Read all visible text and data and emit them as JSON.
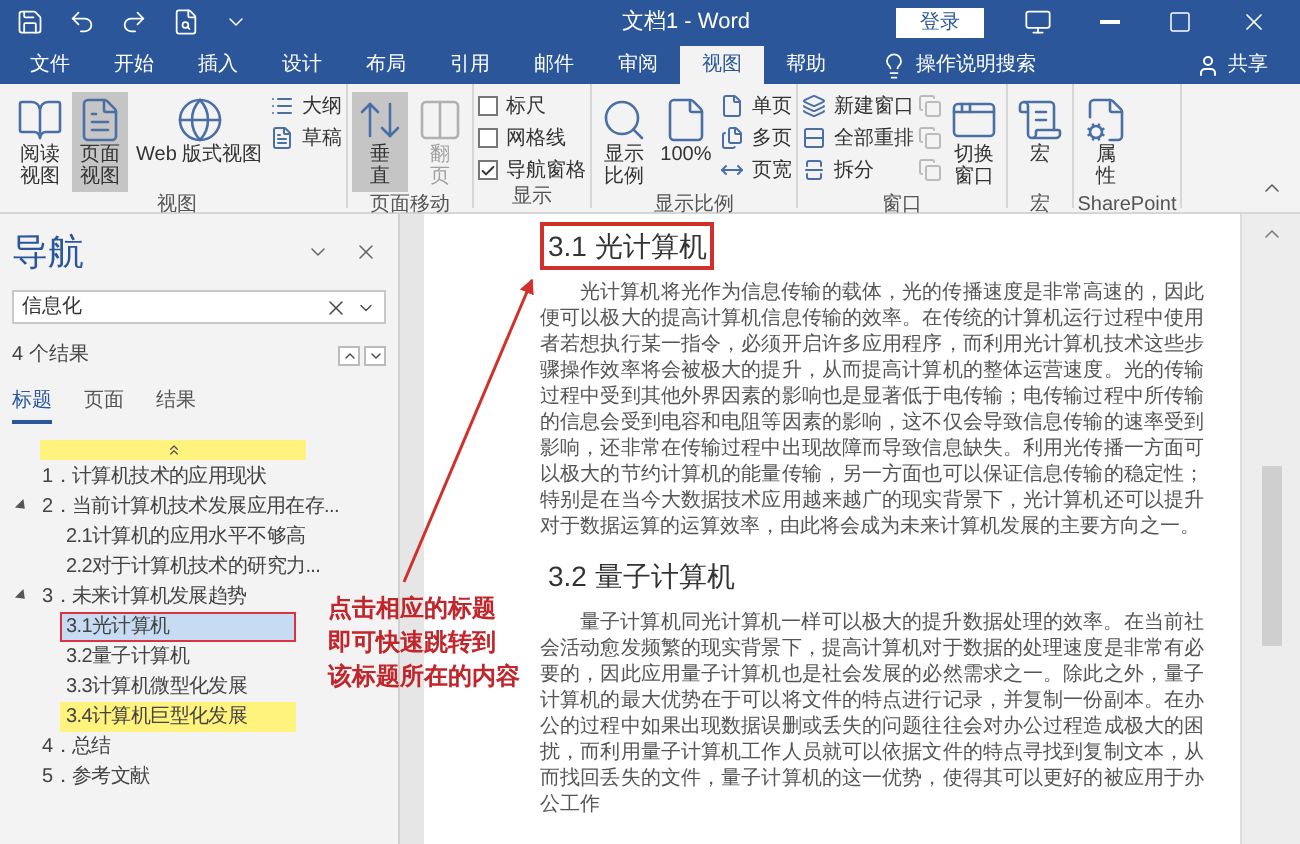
{
  "title_bar": {
    "title": "文档1 - Word",
    "login_button": "登录"
  },
  "menu_tabs": [
    {
      "label": "文件",
      "selected": false
    },
    {
      "label": "开始",
      "selected": false
    },
    {
      "label": "插入",
      "selected": false
    },
    {
      "label": "设计",
      "selected": false
    },
    {
      "label": "布局",
      "selected": false
    },
    {
      "label": "引用",
      "selected": false
    },
    {
      "label": "邮件",
      "selected": false
    },
    {
      "label": "审阅",
      "selected": false
    },
    {
      "label": "视图",
      "selected": true
    },
    {
      "label": "帮助",
      "selected": false
    }
  ],
  "tell_me": "操作说明搜索",
  "share": "共享",
  "ribbon_groups": [
    {
      "label": "视图",
      "items": [
        {
          "kind": "large",
          "label": "阅读视图",
          "selected": false
        },
        {
          "kind": "large",
          "label": "页面视图",
          "selected": true
        },
        {
          "kind": "large",
          "label": "Web 版式视图",
          "selected": false
        },
        {
          "kind": "small",
          "label": "大纲"
        },
        {
          "kind": "small",
          "label": "草稿"
        }
      ]
    },
    {
      "label": "页面移动",
      "items": [
        {
          "kind": "large",
          "label": "垂直",
          "selected": true,
          "disabled": false
        },
        {
          "kind": "large",
          "label": "翻页",
          "selected": false,
          "disabled": true
        }
      ]
    },
    {
      "label": "显示",
      "items": [
        {
          "kind": "check",
          "label": "标尺",
          "checked": false
        },
        {
          "kind": "check",
          "label": "网格线",
          "checked": false
        },
        {
          "kind": "check",
          "label": "导航窗格",
          "checked": true
        }
      ]
    },
    {
      "label": "显示比例",
      "items": [
        {
          "kind": "large",
          "label": "显示比例"
        },
        {
          "kind": "large",
          "label": "100%"
        },
        {
          "kind": "small",
          "label": "单页"
        },
        {
          "kind": "small",
          "label": "多页"
        },
        {
          "kind": "small",
          "label": "页宽"
        }
      ]
    },
    {
      "label": "窗口",
      "items": [
        {
          "kind": "small",
          "label": "新建窗口"
        },
        {
          "kind": "small",
          "label": "全部重排"
        },
        {
          "kind": "small",
          "label": "拆分"
        },
        {
          "kind": "icon",
          "disabled": true
        },
        {
          "kind": "icon",
          "disabled": true
        },
        {
          "kind": "icon",
          "disabled": true
        },
        {
          "kind": "large",
          "label": "切换窗口"
        }
      ]
    },
    {
      "label": "宏",
      "items": [
        {
          "kind": "large",
          "label": "宏"
        }
      ]
    },
    {
      "label": "SharePoint",
      "items": [
        {
          "kind": "large",
          "label": "属性"
        }
      ]
    }
  ],
  "nav": {
    "title": "导航",
    "search": {
      "value": "信息化"
    },
    "results": "4 个结果",
    "tabs": [
      {
        "label": "标题",
        "selected": true
      },
      {
        "label": "页面",
        "selected": false
      },
      {
        "label": "结果",
        "selected": false
      }
    ],
    "tree": [
      {
        "label": "1．计算机技术的应用现状",
        "selected": false,
        "highlighted": false
      },
      {
        "label": "2．当前计算机技术发展应用在存...",
        "selected": false,
        "highlighted": false,
        "expanded": true,
        "children": [
          {
            "label": "2.1计算机的应用水平不够高",
            "selected": false,
            "highlighted": false
          },
          {
            "label": "2.2对于计算机技术的研究力...",
            "selected": false,
            "highlighted": false
          }
        ]
      },
      {
        "label": "3．未来计算机发展趋势",
        "selected": false,
        "highlighted": false,
        "expanded": true,
        "children": [
          {
            "label": "3.1光计算机",
            "selected": true,
            "highlighted": false
          },
          {
            "label": "3.2量子计算机",
            "selected": false,
            "highlighted": false
          },
          {
            "label": "3.3计算机微型化发展",
            "selected": false,
            "highlighted": false
          },
          {
            "label": "3.4计算机巨型化发展",
            "selected": false,
            "highlighted": true
          }
        ]
      },
      {
        "label": "4．总结",
        "selected": false,
        "highlighted": false
      },
      {
        "label": "5．参考文献",
        "selected": false,
        "highlighted": false
      }
    ]
  },
  "annotation": {
    "lines": [
      "点击相应的标题",
      "即可快速跳转到",
      "该标题所在的内容"
    ]
  },
  "document": [
    {
      "kind": "heading",
      "text": "3.1 光计算机",
      "boxed": true
    },
    {
      "kind": "paragraph",
      "text": "光计算机将光作为信息传输的载体，光的传播速度是非常高速的，因此便可以极大的提高计算机信息传输的效率。在传统的计算机运行过程中使用者若想执行某一指令，必须开启许多应用程序，而利用光计算机技术这些步骤操作效率将会被极大的提升，从而提高计算机的整体运营速度。光的传输过程中受到其他外界因素的影响也是显著低于电传输；电传输过程中所传输的信息会受到电容和电阻等因素的影响，这不仅会导致信息传输的速率受到影响，还非常在传输过程中出现故障而导致信息缺失。利用光传播一方面可以极大的节约计算机的能量传输，另一方面也可以保证信息传输的稳定性；特别是在当今大数据技术应用越来越广的现实背景下，光计算机还可以提升对于数据运算的运算效率，由此将会成为未来计算机发展的主要方向之一。"
    },
    {
      "kind": "heading",
      "text": "3.2 量子计算机",
      "boxed": false
    },
    {
      "kind": "paragraph",
      "text": "量子计算机同光计算机一样可以极大的提升数据处理的效率。在当前社会活动愈发频繁的现实背景下，提高计算机对于数据的处理速度是非常有必要的，因此应用量子计算机也是社会发展的必然需求之一。除此之外，量子计算机的最大优势在于可以将文件的特点进行记录，并复制一份副本。在办公的过程中如果出现数据误删或丢失的问题往往会对办公过程造成极大的困扰，而利用量子计算机工作人员就可以依据文件的特点寻找到复制文本，从而找回丢失的文件，量子计算机的这一优势，使得其可以更好的被应用于办公工作"
    }
  ]
}
